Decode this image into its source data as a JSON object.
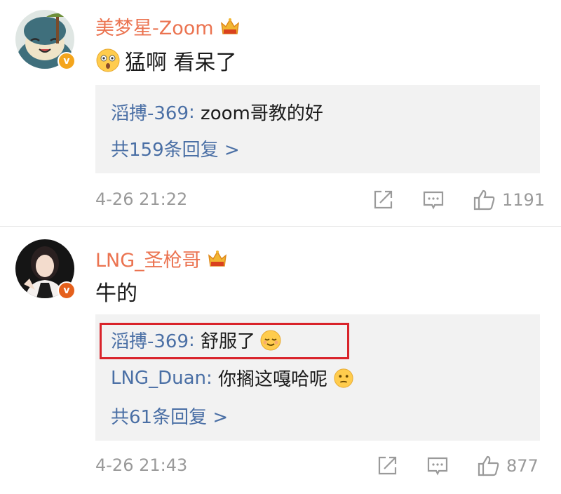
{
  "comments": [
    {
      "username": "美梦星-Zoom",
      "text": "猛啊 看呆了",
      "avatar": "snorlax-avatar",
      "verified_color": "#f4a51c",
      "replies": [
        {
          "name": "滔搏-369",
          "sep": ": ",
          "text": "zoom哥教的好"
        }
      ],
      "more_replies": "共159条回复 >",
      "timestamp": "4-26 21:22",
      "likes": "1191"
    },
    {
      "username": "LNG_圣枪哥",
      "text": "牛的",
      "avatar": "woman-avatar",
      "verified_color": "#e5601c",
      "replies": [
        {
          "name": "滔搏-369",
          "sep": ": ",
          "text": "舒服了"
        },
        {
          "name": "LNG_Duan",
          "sep": ": ",
          "text": "你搁这嘎哈呢"
        }
      ],
      "more_replies": "共61条回复 >",
      "timestamp": "4-26 21:43",
      "likes": "877"
    }
  ],
  "colors": {
    "username": "#eb7350",
    "reply_name": "#4a6fa5",
    "reply_bg": "#f2f2f2",
    "meta": "#9a9a9a",
    "highlight": "#d9232a"
  },
  "icons": {
    "crown": "vip-crown-icon",
    "share": "share-icon",
    "comment": "comment-icon",
    "like": "thumbs-up-icon"
  }
}
